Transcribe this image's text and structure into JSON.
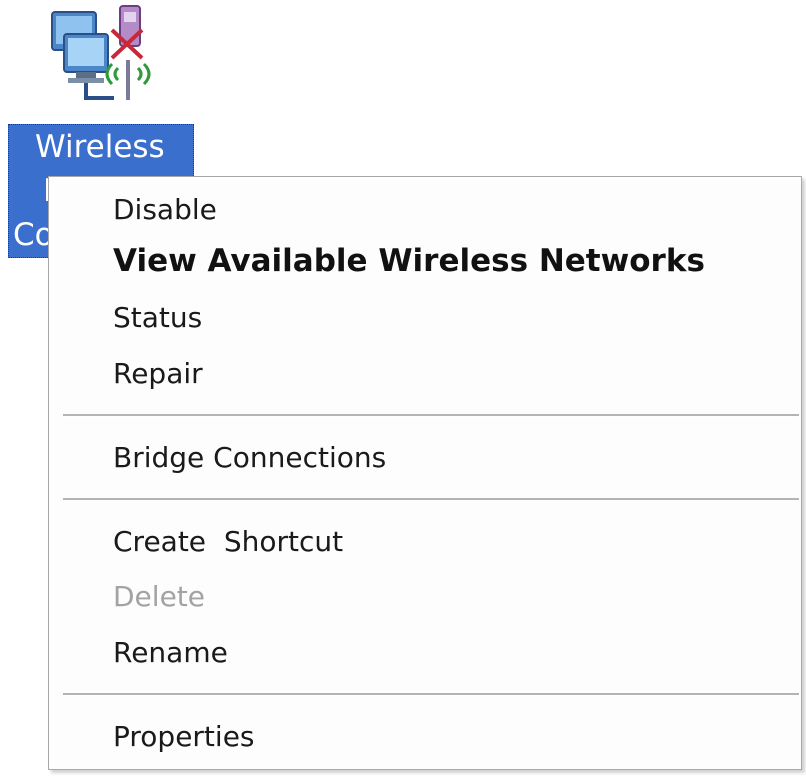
{
  "desktop": {
    "icon_name": "wireless-network-connection-icon",
    "label_lines": [
      "Wireless",
      "N",
      "Co"
    ],
    "label_bg_color": "#3a6fcd"
  },
  "context_menu": {
    "items": [
      {
        "label": "Disable",
        "bold": false,
        "disabled": false
      },
      {
        "label": "View Available Wireless Networks",
        "bold": true,
        "disabled": false
      },
      {
        "label": "Status",
        "bold": false,
        "disabled": false
      },
      {
        "label": "Repair",
        "bold": false,
        "disabled": false
      },
      {
        "label": "Bridge Connections",
        "bold": false,
        "disabled": false
      },
      {
        "label": "Create  Shortcut",
        "bold": false,
        "disabled": false
      },
      {
        "label": "Delete",
        "bold": false,
        "disabled": true
      },
      {
        "label": "Rename",
        "bold": false,
        "disabled": false
      },
      {
        "label": "Properties",
        "bold": false,
        "disabled": false
      }
    ]
  }
}
